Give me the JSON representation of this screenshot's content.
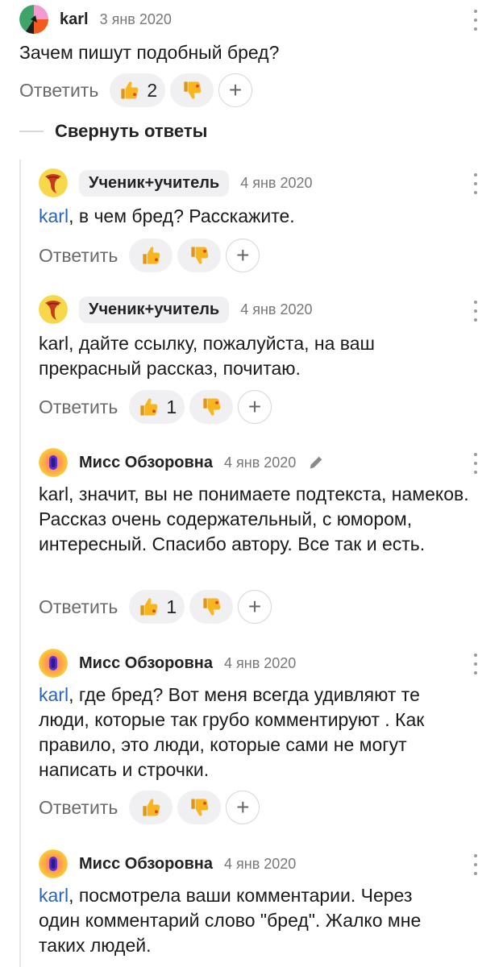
{
  "ui": {
    "reply_label": "Ответить",
    "collapse_label": "Свернуть ответы",
    "plus_label": "+"
  },
  "comments": [
    {
      "author": "karl",
      "date": "3 янв 2020",
      "text": "Зачем пишут подобный бред?",
      "likes": "2",
      "dislikes": ""
    },
    {
      "author": "Ученик+учитель",
      "date": "4 янв 2020",
      "mention": "karl",
      "text": ", в чем бред? Расскажите.",
      "likes": "",
      "dislikes": ""
    },
    {
      "author": "Ученик+учитель",
      "date": "4 янв 2020",
      "text": "karl, дайте ссылку, пожалуйста, на ваш прекрасный рассказ, почитаю.",
      "likes": "1",
      "dislikes": ""
    },
    {
      "author": "Мисс Обзоровна",
      "date": "4 янв 2020",
      "edited": true,
      "text": "karl, значит, вы не понимаете подтекста, намеков. Рассказ очень содержательный, с юмором, интересный. Спасибо автору. Все так и есть.",
      "likes": "1",
      "dislikes": ""
    },
    {
      "author": "Мисс Обзоровна",
      "date": "4 янв 2020",
      "mention": "karl",
      "text": ", где бред? Вот меня всегда удивляют те люди, которые так грубо комментируют . Как правило, это люди, которые сами не могут написать и строчки.",
      "likes": "",
      "dislikes": ""
    },
    {
      "author": "Мисс Обзоровна",
      "date": "4 янв 2020",
      "mention": "karl",
      "text": ", посмотрела ваши комментарии. Через один комментарий слово \"бред\". Жалко мне таких людей.",
      "likes": "",
      "dislikes": ""
    }
  ],
  "colors": {
    "mention": "#2a64b8",
    "pill_bg": "#f0f0f2",
    "thumb": "#f5b21b"
  }
}
